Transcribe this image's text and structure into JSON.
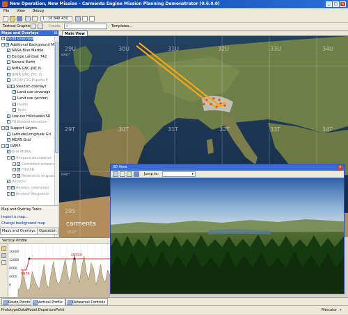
{
  "window": {
    "title": "New Operation, New Mission - Carmenta Engine Mission Planning Demonstrator (0.6.0.0)"
  },
  "menu": {
    "items": [
      "File",
      "View",
      "Debug"
    ]
  },
  "toolbar1": {
    "scale": "1 : 16 848 430"
  },
  "toolbar2": {
    "label": "Tactical Graphics",
    "create_label": "Create",
    "templates_label": "Templates..."
  },
  "left_panel": {
    "header": "Maps and Overlays",
    "tree": [
      {
        "label": "World Overview",
        "level": 0,
        "checked": true,
        "selected": true
      },
      {
        "label": "Additional Background Ma",
        "level": 0,
        "checked": true,
        "expand": "-"
      },
      {
        "label": "NASA Blue Marble",
        "level": 1,
        "checked": true
      },
      {
        "label": "Europe Landsat 742",
        "level": 1,
        "checked": false
      },
      {
        "label": "Natural Earth",
        "level": 1,
        "checked": false
      },
      {
        "label": "NIMA GNC-JNC N",
        "level": 1,
        "checked": false
      },
      {
        "label": "NIMA GNC TPC (S",
        "level": 1,
        "checked": false,
        "gray": true
      },
      {
        "label": "CECAF JOG España P",
        "level": 1,
        "checked": false,
        "gray": true
      },
      {
        "label": "Swedish overlays",
        "level": 1,
        "checked": false,
        "expand": "-"
      },
      {
        "label": "Land use coverage",
        "level": 2,
        "checked": true
      },
      {
        "label": "Land use (winter)",
        "level": 2,
        "checked": false
      },
      {
        "label": "Roads",
        "level": 2,
        "checked": false,
        "gray": true
      },
      {
        "label": "Texts",
        "level": 2,
        "checked": false,
        "gray": true
      },
      {
        "label": "Low-res Hillshaded SR",
        "level": 1,
        "checked": true
      },
      {
        "label": "Hillshaded elevation",
        "level": 1,
        "checked": false,
        "gray": true
      },
      {
        "label": "Support Layers",
        "level": 0,
        "checked": true,
        "expand": "-"
      },
      {
        "label": "Latitude/Longitude Gri",
        "level": 1,
        "checked": false
      },
      {
        "label": "MGRS Grid",
        "level": 1,
        "checked": true
      },
      {
        "label": "DAFIF",
        "level": 0,
        "checked": true,
        "expand": "-"
      },
      {
        "label": "Grid MORA",
        "level": 1,
        "checked": true,
        "gray": true
      },
      {
        "label": "Airspace boundaries",
        "level": 1,
        "checked": true,
        "gray": true,
        "expand": "-"
      },
      {
        "label": "Controlled airspace",
        "level": 2,
        "checked": true,
        "gray": true,
        "expand": "+"
      },
      {
        "label": "FIR/UIR",
        "level": 2,
        "checked": true,
        "gray": true,
        "expand": "+"
      },
      {
        "label": "Restrictive airspace",
        "level": 2,
        "checked": true,
        "gray": true,
        "expand": "+"
      },
      {
        "label": "Airports",
        "level": 1,
        "checked": true,
        "gray": true
      },
      {
        "label": "Airways (overview)",
        "level": 1,
        "checked": true,
        "gray": true,
        "expand": "+"
      },
      {
        "label": "Enroute Waypoints",
        "level": 1,
        "checked": true,
        "gray": true,
        "expand": "+"
      }
    ],
    "tasks_header": "Map and Overlay Tasks",
    "tasks": [
      "Import a map...",
      "Change background map dimming..."
    ],
    "tabs": [
      "Maps and Overlays",
      "Operation"
    ]
  },
  "main_view": {
    "tab": "Main View",
    "zones": [
      "29U",
      "30U",
      "31U",
      "32U",
      "33U",
      "34U",
      "29T",
      "30T",
      "31T",
      "32T",
      "33T",
      "34T",
      "29S"
    ],
    "lat_labels": [
      "N50°",
      "N40°",
      "W10°"
    ],
    "logo": "carmenta"
  },
  "view3d": {
    "title": "3D View",
    "jump_label": "Jump to:"
  },
  "vertical_profile": {
    "header": "Vertical Profile",
    "alt_labels": [
      "16000",
      "12000",
      "8000",
      "4000",
      "0"
    ],
    "altitude_segment": "10000",
    "start_altitude": "6976",
    "terrain": [
      12,
      15,
      40,
      22,
      10,
      14,
      38,
      26,
      18,
      12,
      30,
      48,
      20,
      14,
      35,
      52,
      30,
      18,
      25,
      40,
      56,
      34,
      20,
      46,
      62,
      38,
      22,
      44,
      60,
      36,
      26,
      50,
      42,
      18,
      30,
      48,
      28,
      22,
      40,
      32
    ]
  },
  "bottom_tabs": [
    "Route Points",
    "Vertical Profile",
    "Rehearsal Controls"
  ],
  "status": {
    "left": "PrototypeDataModel.DeparturePoint",
    "projection": "Mercator"
  }
}
